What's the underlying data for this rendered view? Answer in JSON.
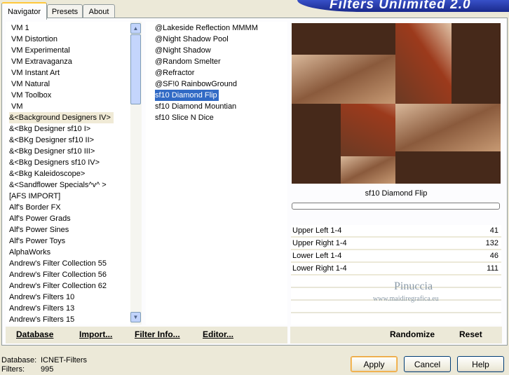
{
  "tabs": [
    {
      "label": "Navigator"
    },
    {
      "label": "Presets"
    },
    {
      "label": "About"
    }
  ],
  "banner_title": "Filters Unlimited 2.0",
  "categories": [
    "VM 1",
    "VM Distortion",
    "VM Experimental",
    "VM Extravaganza",
    "VM Instant Art",
    "VM Natural",
    "VM Toolbox",
    "VM",
    "&<Background Designers IV>",
    "&<Bkg Designer sf10 I>",
    "&<BKg Designer sf10 II>",
    "&<Bkg Designer sf10 III>",
    "&<Bkg Designers sf10 IV>",
    "&<Bkg Kaleidoscope>",
    "&<Sandflower Specials^v^ >",
    "[AFS IMPORT]",
    "Alf's Border FX",
    "Alf's Power Grads",
    "Alf's Power Sines",
    "Alf's Power Toys",
    "AlphaWorks",
    "Andrew's Filter Collection 55",
    "Andrew's Filter Collection 56",
    "Andrew's Filter Collection 62",
    "Andrew's Filters 10",
    "Andrew's Filters 13",
    "Andrew's Filters 15"
  ],
  "filters": [
    "@Lakeside Reflection MMMM",
    "@Night Shadow Pool",
    "@Night Shadow",
    "@Random Smelter",
    "@Refractor",
    "@SF!0 RainbowGround",
    "sf10 Diamond Flip",
    "sf10 Diamond Mountian",
    "sf10 Slice N Dice"
  ],
  "preview_caption": "sf10 Diamond Flip",
  "params": [
    {
      "label": "Upper Left 1-4",
      "value": "41"
    },
    {
      "label": "Upper Right 1-4",
      "value": "132"
    },
    {
      "label": "Lower Left 1-4",
      "value": "46"
    },
    {
      "label": "Lower Right 1-4",
      "value": "111"
    }
  ],
  "toolbar": {
    "database": "Database",
    "import": "Import...",
    "filter_info": "Filter Info...",
    "editor": "Editor...",
    "randomize": "Randomize",
    "reset": "Reset"
  },
  "status": {
    "database_label": "Database:",
    "database_value": "ICNET-Filters",
    "filters_label": "Filters:",
    "filters_value": "995"
  },
  "buttons": {
    "apply": "Apply",
    "cancel": "Cancel",
    "help": "Help"
  },
  "watermark": {
    "name": "Pinuccia",
    "site": "www.maidiregrafica.eu"
  },
  "colors": {
    "selection": "#316ac5",
    "highlight": "#f0ead6",
    "accent": "#ffc83c"
  }
}
